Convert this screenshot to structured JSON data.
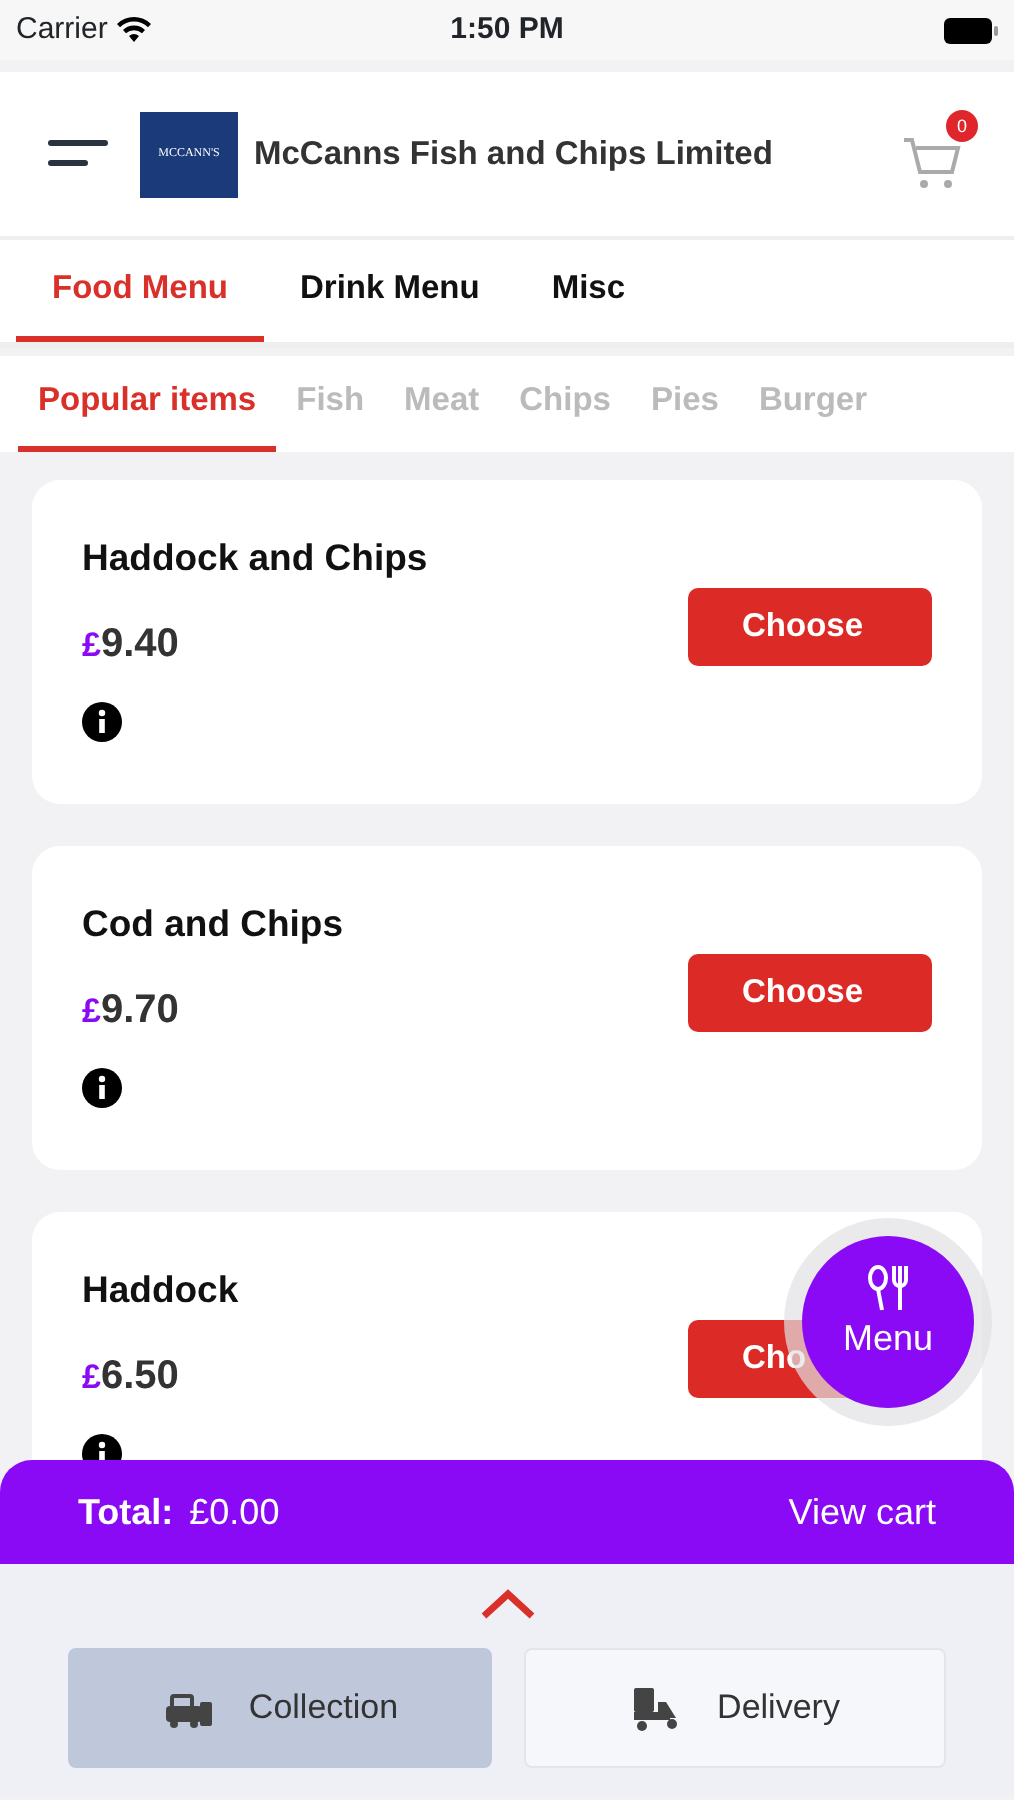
{
  "status_bar": {
    "carrier": "Carrier",
    "time": "1:50 PM"
  },
  "header": {
    "logo_text": "MCCANN'S",
    "title": "McCanns Fish and Chips Limited",
    "cart_count": "0"
  },
  "tabs": [
    {
      "label": "Food Menu",
      "selected": true
    },
    {
      "label": "Drink Menu",
      "selected": false
    },
    {
      "label": "Misc",
      "selected": false
    }
  ],
  "categories": [
    {
      "label": "Popular items",
      "selected": true
    },
    {
      "label": "Fish",
      "selected": false
    },
    {
      "label": "Meat",
      "selected": false
    },
    {
      "label": "Chips",
      "selected": false
    },
    {
      "label": "Pies",
      "selected": false
    },
    {
      "label": "Burger",
      "selected": false
    }
  ],
  "items": [
    {
      "name": "Haddock and Chips",
      "currency": "£",
      "price": "9.40",
      "button": "Choose"
    },
    {
      "name": "Cod and Chips",
      "currency": "£",
      "price": "9.70",
      "button": "Choose"
    },
    {
      "name": "Haddock",
      "currency": "£",
      "price": "6.50",
      "button": "Cho"
    }
  ],
  "menu_button": {
    "label": "Menu"
  },
  "total_bar": {
    "label": "Total:",
    "amount": "£0.00",
    "link": "View cart"
  },
  "order_types": [
    {
      "label": "Collection",
      "kind": "collection",
      "selected": true
    },
    {
      "label": "Delivery",
      "kind": "delivery",
      "selected": false
    }
  ]
}
